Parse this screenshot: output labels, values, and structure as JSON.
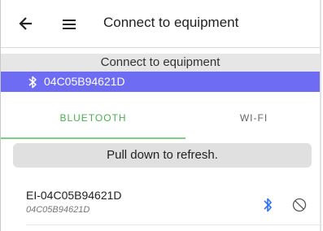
{
  "topbar": {
    "title": "Connect to equipment",
    "back_icon": "arrow-left-icon",
    "menu_icon": "hamburger-menu-icon"
  },
  "subheader": {
    "title": "Connect to equipment"
  },
  "connected_device": {
    "icon": "bluetooth-icon",
    "id": "04C05B94621D",
    "background_color": "#6d6cf2"
  },
  "tabs": [
    {
      "label": "BLUETOOTH",
      "selected": true,
      "color": "#4caf50"
    },
    {
      "label": "WI-FI",
      "selected": false
    }
  ],
  "refresh_hint": "Pull down to refresh.",
  "devices": [
    {
      "name": "EI-04C05B94621D",
      "address": "04C05B94621D",
      "connection_icon": "bluetooth-icon",
      "connection_icon_color": "#2f6ff0",
      "action_icon": "block-icon"
    }
  ]
}
